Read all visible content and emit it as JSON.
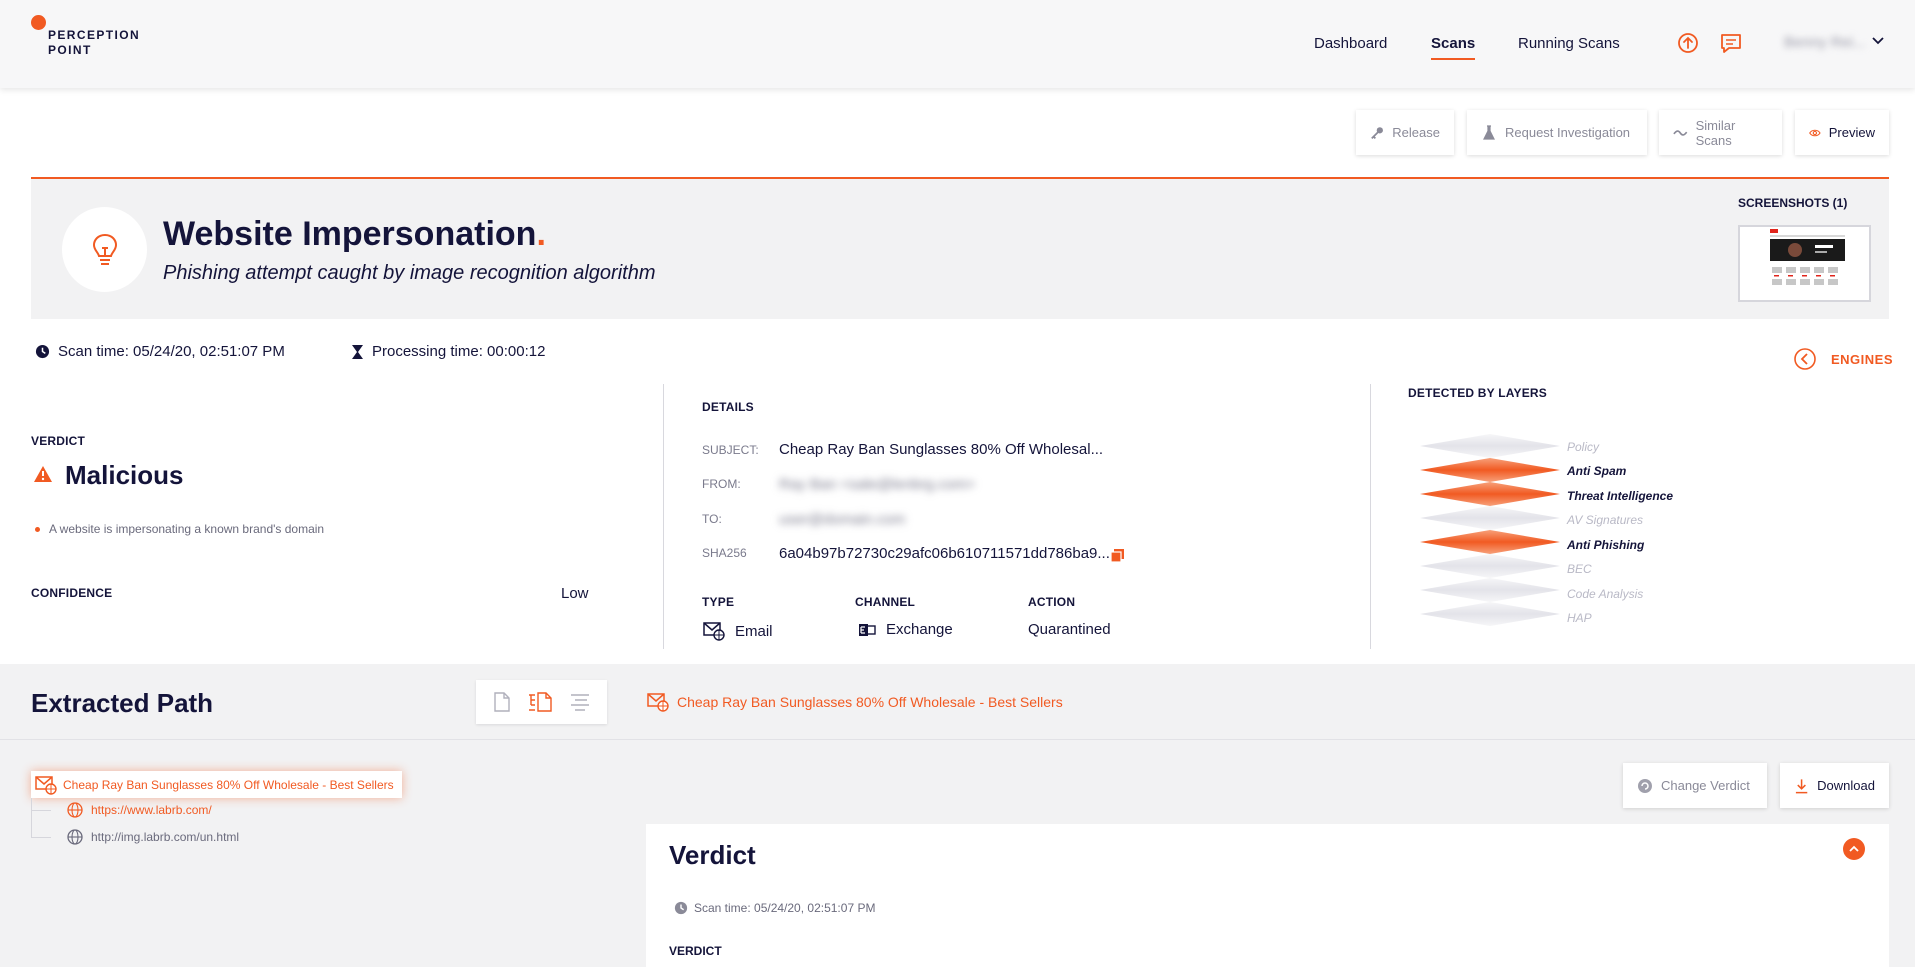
{
  "brand": {
    "line1": "PERCEPTION",
    "line2": "POINT",
    "accent_color": "#f15a22"
  },
  "nav": {
    "items": [
      {
        "label": "Dashboard"
      },
      {
        "label": "Scans"
      },
      {
        "label": "Running Scans"
      }
    ],
    "active": "Scans",
    "upload_icon": "upload-icon",
    "message_icon": "message-icon",
    "user_name": "Benny Rei..."
  },
  "actions": {
    "release": "Release",
    "request_investigation": "Request Investigation",
    "similar_scans": "Similar Scans",
    "preview": "Preview"
  },
  "summary": {
    "title": "Website Impersonation",
    "title_dot": ".",
    "subtitle": "Phishing attempt caught by image recognition algorithm",
    "screenshots_label": "SCREENSHOTS (1)"
  },
  "scan_meta": {
    "scan_time": "Scan time: 05/24/20, 02:51:07 PM",
    "processing_time": "Processing time: 00:00:12",
    "engines_label": "ENGINES"
  },
  "verdict": {
    "label": "VERDICT",
    "value": "Malicious",
    "reason": "A website is impersonating a known brand's domain",
    "confidence_label": "CONFIDENCE",
    "confidence_value": "Low"
  },
  "details": {
    "heading": "DETAILS",
    "subject_key": "SUBJECT:",
    "subject_val": "Cheap Ray Ban Sunglasses 80% Off Wholesal...",
    "from_key": "FROM:",
    "from_val": "Ray Ban <sale@lenbrg.com>",
    "to_key": "TO:",
    "to_val": "user@domain.com",
    "sha_key": "SHA256",
    "sha_val": "6a04b97b72730c29afc06b610711571dd786ba9...",
    "type_label": "TYPE",
    "type_val": "Email",
    "channel_label": "CHANNEL",
    "channel_val": "Exchange",
    "action_label": "ACTION",
    "action_val": "Quarantined"
  },
  "layers": {
    "heading": "DETECTED BY LAYERS",
    "items": [
      {
        "name": "Policy",
        "detected": false
      },
      {
        "name": "Anti Spam",
        "detected": true
      },
      {
        "name": "Threat Intelligence",
        "detected": true
      },
      {
        "name": "AV Signatures",
        "detected": false
      },
      {
        "name": "Anti Phishing",
        "detected": true
      },
      {
        "name": "BEC",
        "detected": false
      },
      {
        "name": "Code Analysis",
        "detected": false
      },
      {
        "name": "HAP",
        "detected": false
      }
    ]
  },
  "extracted": {
    "title": "Extracted Path",
    "breadcrumb": "Cheap Ray Ban Sunglasses 80% Off Wholesale - Best Sellers",
    "root": "Cheap Ray Ban Sunglasses 80% Off Wholesale - Best Sellers",
    "children": [
      {
        "label": "https://www.labrb.com/",
        "flagged": true
      },
      {
        "label": "http://img.labrb.com/un.html",
        "flagged": false
      }
    ],
    "change_verdict": "Change Verdict",
    "download": "Download"
  },
  "verdict_card": {
    "title": "Verdict",
    "scan_time": "Scan time: 05/24/20, 02:51:07 PM",
    "verdict_label": "VERDICT"
  }
}
